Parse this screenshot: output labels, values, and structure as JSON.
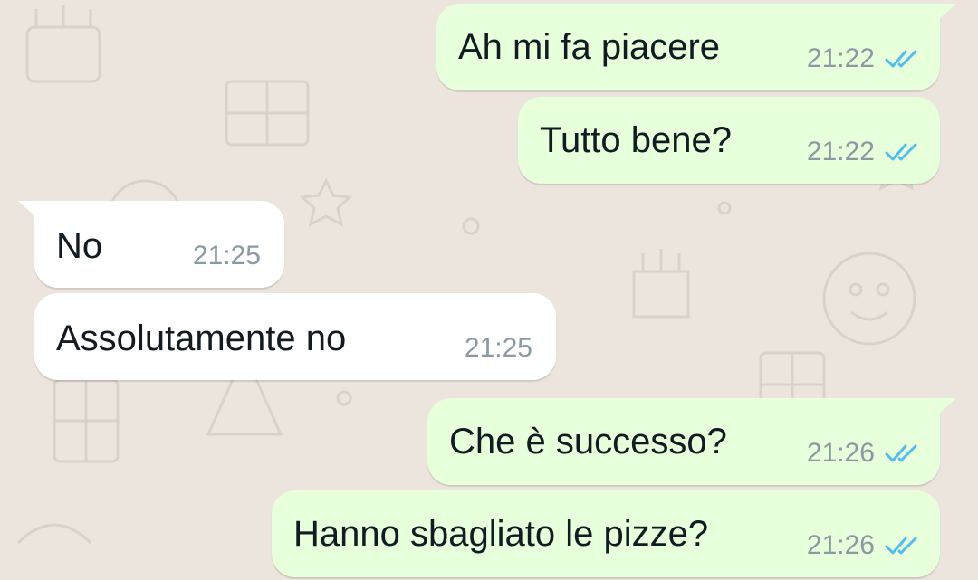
{
  "chat": {
    "messages": [
      {
        "direction": "out",
        "text": "Ah mi fa piacere",
        "time": "21:22",
        "status": "read"
      },
      {
        "direction": "out",
        "text": "Tutto bene?",
        "time": "21:22",
        "status": "read"
      },
      {
        "direction": "in",
        "text": "No",
        "time": "21:25"
      },
      {
        "direction": "in",
        "text": "Assolutamente no",
        "time": "21:25"
      },
      {
        "direction": "out",
        "text": "Che è successo?",
        "time": "21:26",
        "status": "read"
      },
      {
        "direction": "out",
        "text": "Hanno sbagliato le pizze?",
        "time": "21:26",
        "status": "read"
      }
    ]
  },
  "icons": {
    "read_receipt": "double-check-icon"
  },
  "colors": {
    "outgoing_bubble": "#e7ffdb",
    "incoming_bubble": "#ffffff",
    "read_ticks": "#53bdeb",
    "timestamp": "#8a9aa3",
    "background": "#ece5dd"
  }
}
